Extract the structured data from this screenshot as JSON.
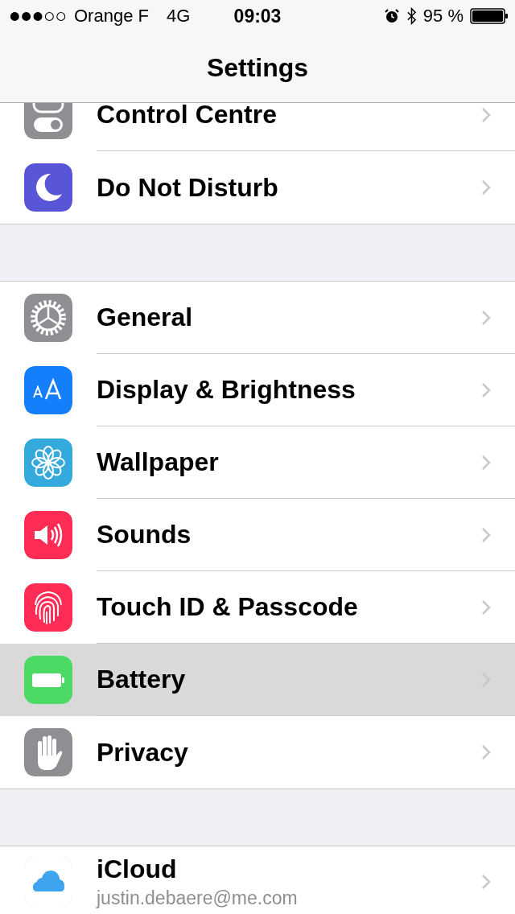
{
  "status_bar": {
    "carrier": "Orange F",
    "network": "4G",
    "time": "09:03",
    "battery": "95 %"
  },
  "nav": {
    "title": "Settings"
  },
  "groups": [
    {
      "rows": [
        {
          "label": "Control Centre",
          "kind": "toggles",
          "selected": false
        },
        {
          "label": "Do Not Disturb",
          "kind": "moon",
          "selected": false
        }
      ]
    },
    {
      "rows": [
        {
          "label": "General",
          "kind": "gear",
          "selected": false
        },
        {
          "label": "Display & Brightness",
          "kind": "text-size",
          "selected": false
        },
        {
          "label": "Wallpaper",
          "kind": "flower",
          "selected": false
        },
        {
          "label": "Sounds",
          "kind": "speaker",
          "selected": false
        },
        {
          "label": "Touch ID & Passcode",
          "kind": "fingerprint",
          "selected": false
        },
        {
          "label": "Battery",
          "kind": "battery",
          "selected": true
        },
        {
          "label": "Privacy",
          "kind": "hand",
          "selected": false
        }
      ]
    },
    {
      "rows": [
        {
          "label": "iCloud",
          "subtitle": "justin.debaere@me.com",
          "kind": "cloud",
          "selected": false
        }
      ]
    }
  ]
}
